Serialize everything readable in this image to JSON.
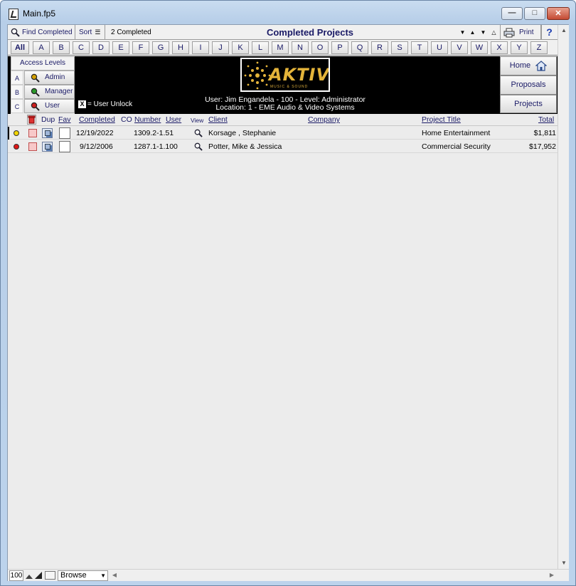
{
  "window": {
    "title": "Main.fp5"
  },
  "toolbar": {
    "find_label": "Find Completed",
    "sort_label": "Sort",
    "count_label": "2 Completed",
    "page_title": "Completed Projects",
    "print_label": "Print",
    "help_label": "?"
  },
  "alphabet": [
    "All",
    "A",
    "B",
    "C",
    "D",
    "E",
    "F",
    "G",
    "H",
    "I",
    "J",
    "K",
    "L",
    "M",
    "N",
    "O",
    "P",
    "Q",
    "R",
    "S",
    "T",
    "U",
    "V",
    "W",
    "X",
    "Y",
    "Z"
  ],
  "access": {
    "title": "Access Levels",
    "levels": [
      {
        "letter": "A",
        "label": "Admin",
        "icon_color": "#d4a000"
      },
      {
        "letter": "B",
        "label": "Manager",
        "icon_color": "#2a9a2a"
      },
      {
        "letter": "C",
        "label": "User",
        "icon_color": "#cc2020"
      }
    ],
    "unlock_mark": "X",
    "unlock_label": "= User Unlock"
  },
  "logo": {
    "text": "AKTIV",
    "subtext": "MUSIC & SOUND"
  },
  "user_info": {
    "line1": "User: Jim Engandela - 100 - Level: Administrator",
    "line2": "Location: 1 - EME Audio & Video Systems"
  },
  "nav": {
    "home": "Home",
    "proposals": "Proposals",
    "projects": "Projects"
  },
  "columns": {
    "dup": "Dup",
    "fav": "Fav",
    "completed": "Completed",
    "co": "CO",
    "number": "Number",
    "user": "User",
    "view": "View",
    "client": "Client",
    "company": "Company",
    "project_title": "Project Title",
    "total": "Total"
  },
  "rows": [
    {
      "status_color": "#f2d400",
      "completed": "12/19/2022",
      "number": "1309.2-1.51",
      "client": "Korsage , Stephanie",
      "company": "",
      "project_title": "Home Entertainment",
      "total": "$1,811"
    },
    {
      "status_color": "#e01818",
      "completed": "9/12/2006",
      "number": "1287.1-1.100",
      "client": "Potter, Mike & Jessica",
      "company": "",
      "project_title": "Commercial Security",
      "total": "$17,952"
    }
  ],
  "status_bar": {
    "zoom": "100",
    "mode": "Browse"
  },
  "colors": {
    "accent_text": "#1a1a66",
    "banner_bg": "#000000",
    "logo_gold": "#e4b43a"
  }
}
